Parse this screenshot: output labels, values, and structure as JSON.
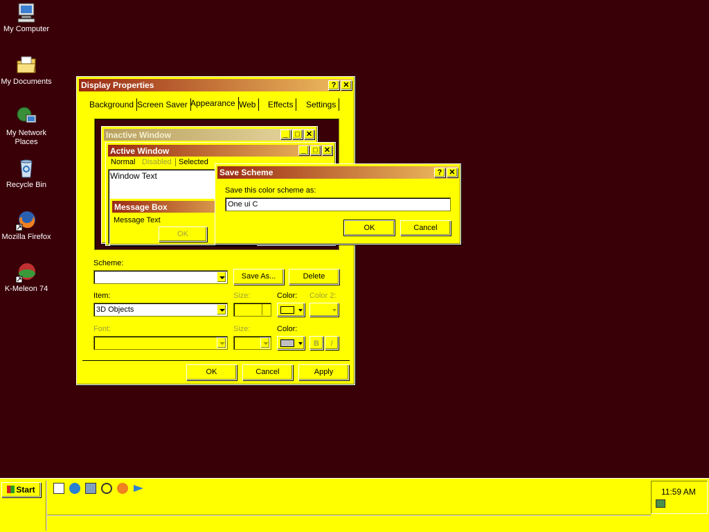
{
  "desktop": {
    "icons": [
      {
        "label": "My Computer"
      },
      {
        "label": "My Documents"
      },
      {
        "label": "My Network Places"
      },
      {
        "label": "Recycle Bin"
      },
      {
        "label": "Mozilla Firefox"
      },
      {
        "label": "K-Meleon 74"
      }
    ]
  },
  "display_properties": {
    "title": "Display Properties",
    "help": "?",
    "close": "✕",
    "tabs": [
      "Background",
      "Screen Saver",
      "Appearance",
      "Web",
      "Effects",
      "Settings"
    ],
    "preview": {
      "inactive_title": "Inactive Window",
      "active_title": "Active Window",
      "menu": [
        "Normal",
        "Disabled",
        "Selected"
      ],
      "window_text": "Window Text",
      "message_box_title": "Message Box",
      "message_text": "Message Text",
      "ok": "OK"
    },
    "scheme_label": "Scheme:",
    "scheme_value": "",
    "save_as": "Save As...",
    "delete": "Delete",
    "item_label": "Item:",
    "item_value": "3D Objects",
    "size_label": "Size:",
    "color_label": "Color:",
    "color2_label": "Color 2:",
    "font_label": "Font:",
    "font_size_label": "Size:",
    "font_color_label": "Color:",
    "bold": "B",
    "italic": "I",
    "ok": "OK",
    "cancel": "Cancel",
    "apply": "Apply"
  },
  "save_scheme": {
    "title": "Save Scheme",
    "help": "?",
    "close": "✕",
    "prompt": "Save this color scheme as:",
    "value": "One ui C",
    "ok": "OK",
    "cancel": "Cancel"
  },
  "taskbar": {
    "start": "Start",
    "time": "11:59 AM"
  },
  "colors": {
    "desktop": "#3a0008",
    "face": "#ffff00",
    "active_title_start": "#9a2a14",
    "active_title_end": "#f0c060"
  }
}
